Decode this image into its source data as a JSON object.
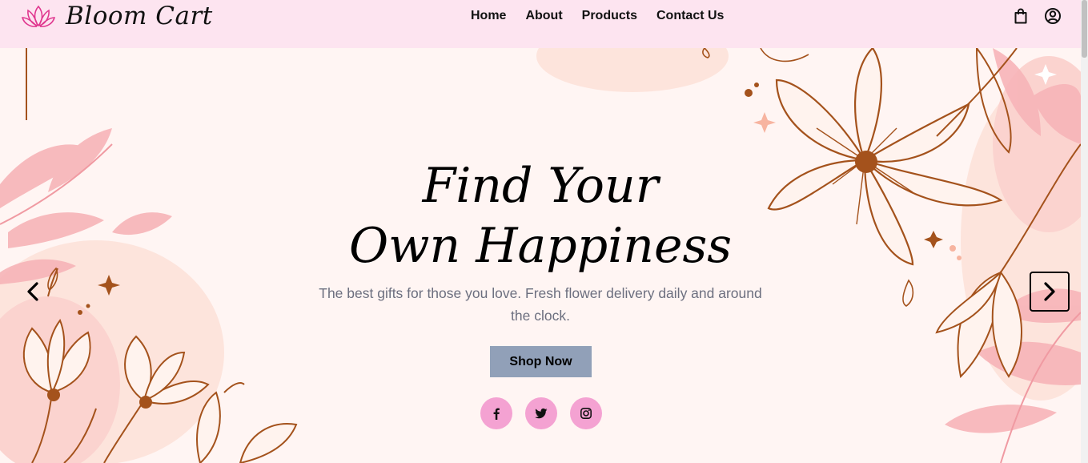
{
  "brand": {
    "name": "Bloom Cart",
    "logo_icon": "lotus-icon"
  },
  "nav": {
    "links": [
      "Home",
      "About",
      "Products",
      "Contact Us"
    ],
    "cart_icon": "shopping-bag-icon",
    "account_icon": "user-circle-icon"
  },
  "hero": {
    "title_line1": "Find Your",
    "title_line2": "Own Happiness",
    "subtitle": "The best gifts for those you love. Fresh flower delivery daily and around the clock.",
    "cta_label": "Shop Now",
    "prev_icon": "chevron-left-icon",
    "next_icon": "chevron-right-icon"
  },
  "social": [
    "facebook-icon",
    "twitter-icon",
    "instagram-icon"
  ],
  "colors": {
    "navbar_bg": "#fde4f0",
    "hero_bg": "#fff5f3",
    "cta_bg": "#91a0b8",
    "social_bg": "#f4a2d2",
    "floral_line": "#a4521c",
    "logo_pink": "#e0378f"
  }
}
